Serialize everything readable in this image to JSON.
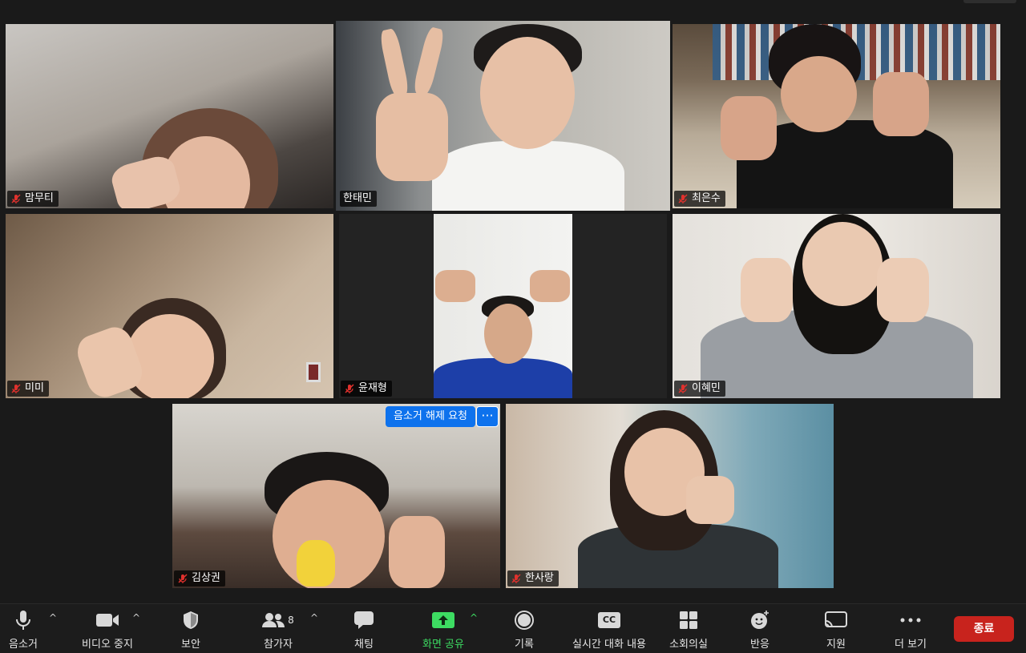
{
  "tiles": [
    {
      "name": "맘무티",
      "muted": true,
      "active": false
    },
    {
      "name": "한태민",
      "muted": false,
      "active": true
    },
    {
      "name": "최은수",
      "muted": true,
      "active": false
    },
    {
      "name": "미미",
      "muted": true,
      "active": false
    },
    {
      "name": "윤재형",
      "muted": true,
      "active": false
    },
    {
      "name": "이혜민",
      "muted": true,
      "active": false
    },
    {
      "name": "김상권",
      "muted": true,
      "active": false
    },
    {
      "name": "한사랑",
      "muted": true,
      "active": false
    }
  ],
  "tile_actions": {
    "request_unmute_label": "음소거 해제 요청",
    "more_label": "···"
  },
  "toolbar": {
    "mute_label": "음소거",
    "video_label": "비디오 중지",
    "security_label": "보안",
    "participants_label": "참가자",
    "participants_count": "8",
    "chat_label": "채팅",
    "share_label": "화면 공유",
    "record_label": "기록",
    "captions_label": "실시간 대화 내용",
    "captions_icon_text": "CC",
    "breakout_label": "소회의실",
    "reactions_label": "반응",
    "support_label": "지원",
    "more_label": "더 보기",
    "end_label": "종료"
  },
  "colors": {
    "active_speaker_border": "#d6e58a",
    "share_green": "#3ddc62",
    "end_red": "#c8231d",
    "request_blue": "#0e72ed",
    "muted_red": "#e0312d"
  },
  "icons": [
    "microphone-icon",
    "video-camera-icon",
    "shield-icon",
    "participants-icon",
    "chat-bubble-icon",
    "share-screen-icon",
    "record-icon",
    "captions-icon",
    "grid-icon",
    "emoji-reaction-icon",
    "cast-icon",
    "ellipsis-icon",
    "muted-mic-icon"
  ]
}
